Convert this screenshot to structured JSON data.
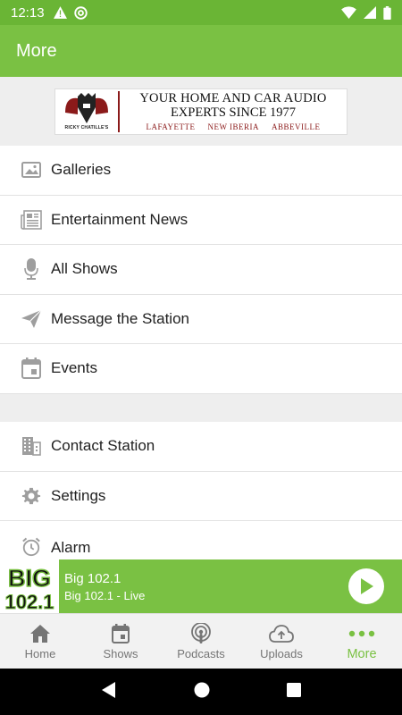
{
  "status_bar": {
    "time": "12:13",
    "left_icons": [
      "warning-icon",
      "at-sign-icon"
    ],
    "right_icons": [
      "wifi-icon",
      "signal-icon",
      "battery-icon"
    ]
  },
  "app_bar": {
    "title": "More"
  },
  "ad": {
    "logo_text": "RICKY CHATILLE'S",
    "line1": "YOUR HOME AND CAR AUDIO",
    "line2": "EXPERTS SINCE 1977",
    "locations": [
      "LAFAYETTE",
      "NEW IBERIA",
      "ABBEVILLE"
    ]
  },
  "menu_group1": [
    {
      "label": "Galleries",
      "icon": "image-icon"
    },
    {
      "label": "Entertainment News",
      "icon": "newspaper-icon"
    },
    {
      "label": "All Shows",
      "icon": "microphone-icon"
    },
    {
      "label": "Message the Station",
      "icon": "send-icon"
    },
    {
      "label": "Events",
      "icon": "calendar-icon"
    }
  ],
  "menu_group2": [
    {
      "label": "Contact Station",
      "icon": "building-icon"
    },
    {
      "label": "Settings",
      "icon": "gear-icon"
    },
    {
      "label": "Alarm",
      "icon": "alarm-clock-icon"
    }
  ],
  "now_playing": {
    "logo_text_top": "BIG",
    "logo_text_bottom": "102.1",
    "title": "Big 102.1",
    "subtitle": "Big 102.1 - Live"
  },
  "bottom_nav": [
    {
      "label": "Home",
      "icon": "home-icon",
      "active": false
    },
    {
      "label": "Shows",
      "icon": "calendar-icon",
      "active": false
    },
    {
      "label": "Podcasts",
      "icon": "podcast-icon",
      "active": false
    },
    {
      "label": "Uploads",
      "icon": "cloud-upload-icon",
      "active": false
    },
    {
      "label": "More",
      "icon": "more-dots-icon",
      "active": true
    }
  ],
  "colors": {
    "primary": "#7ac143",
    "status_bar": "#6ab535",
    "icon_gray": "#9e9e9e"
  }
}
